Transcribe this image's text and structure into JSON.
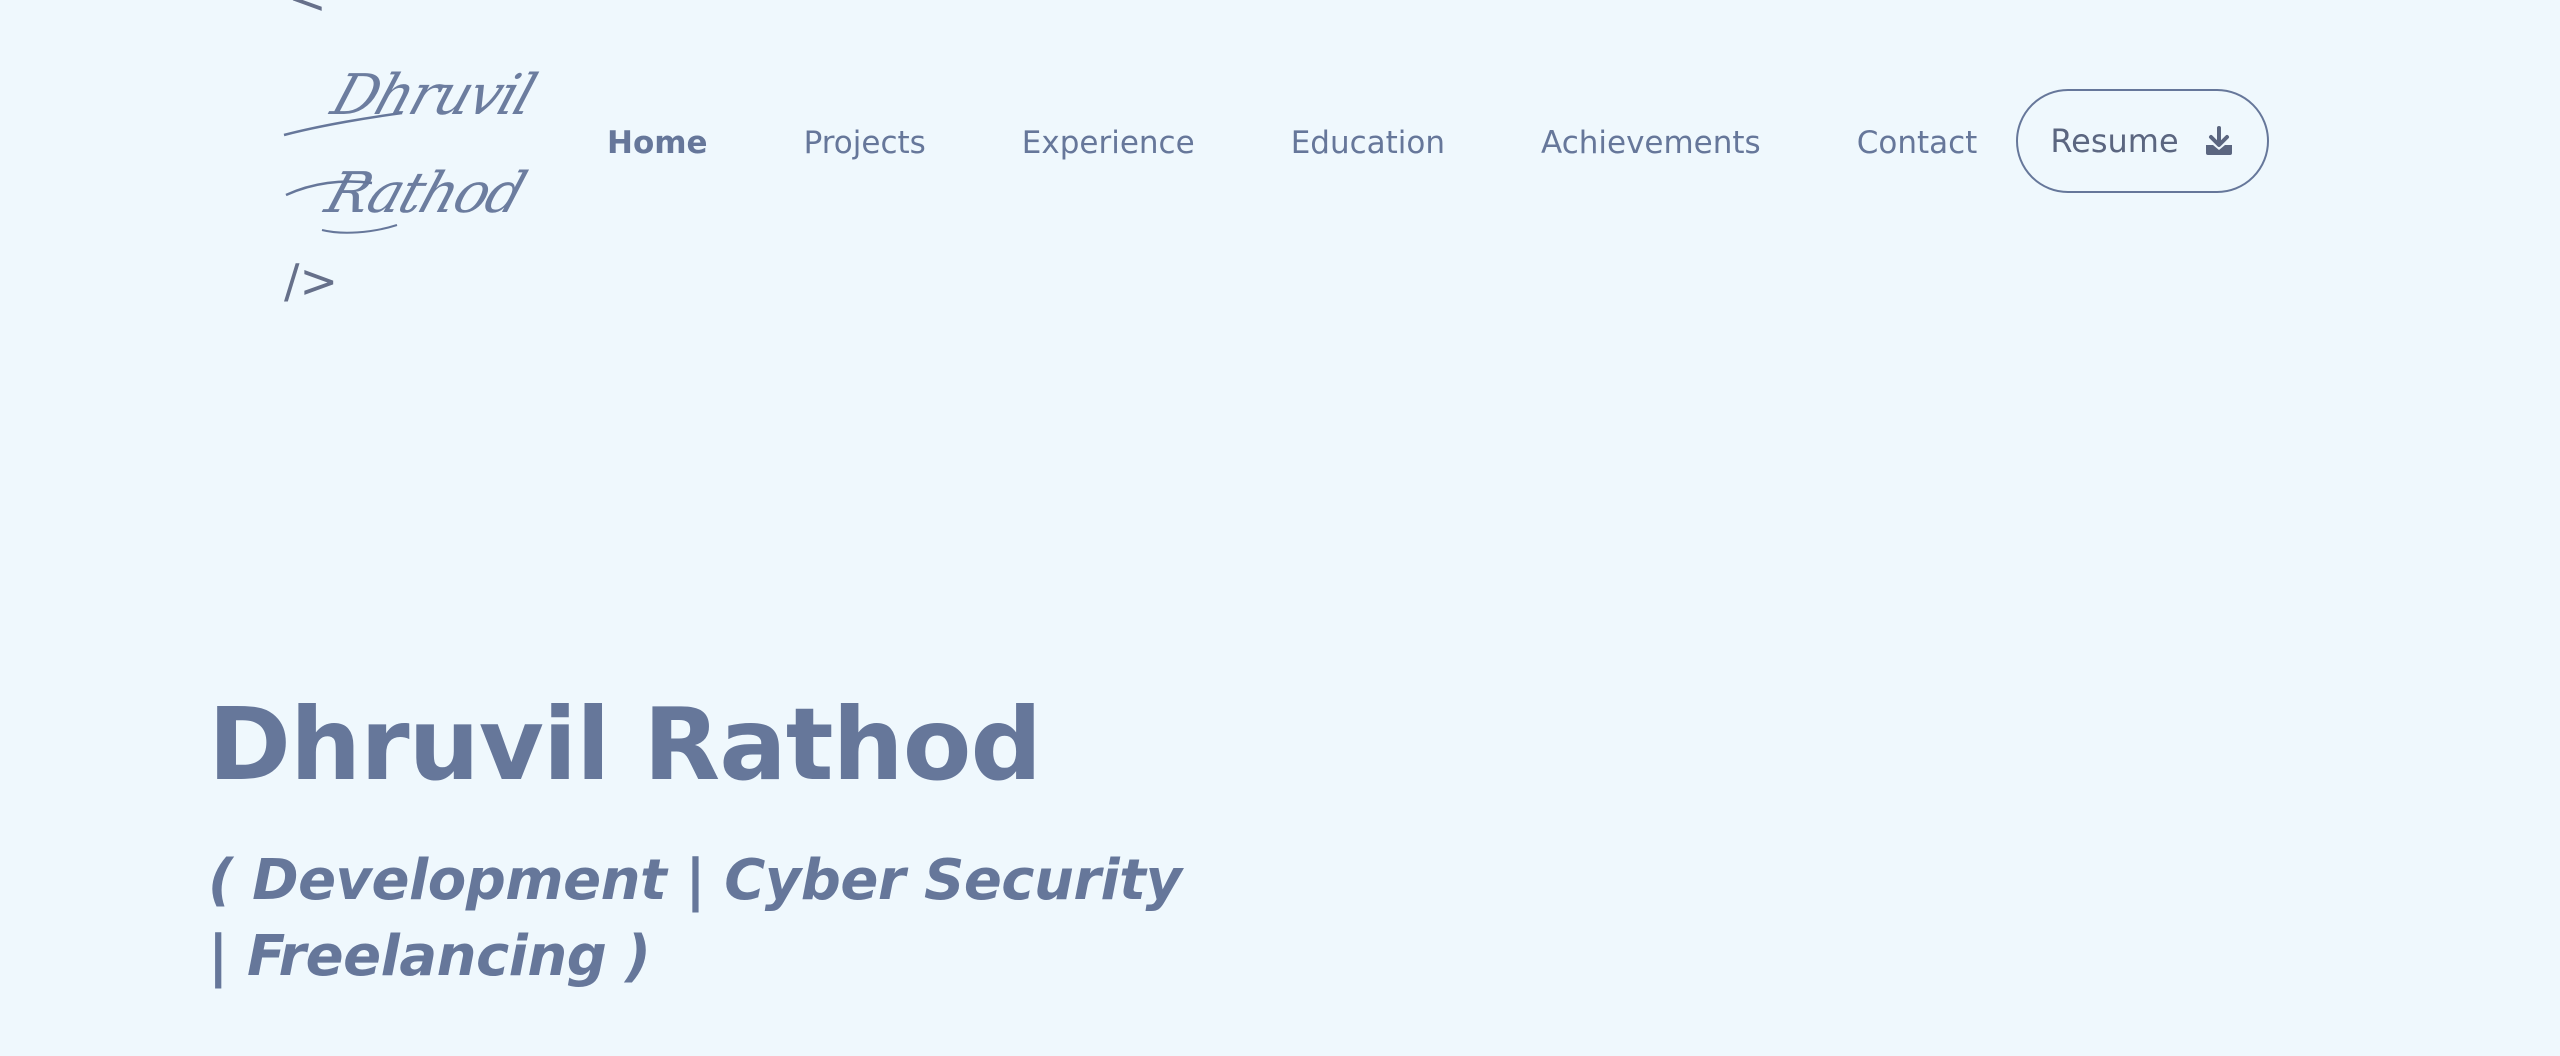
{
  "logo": {
    "bracket_open": "<",
    "signature_line1": "Dhruvil",
    "signature_line2": "Rathod",
    "bracket_close": "/>"
  },
  "nav": {
    "items": [
      {
        "label": "Home",
        "active": true
      },
      {
        "label": "Projects",
        "active": false
      },
      {
        "label": "Experience",
        "active": false
      },
      {
        "label": "Education",
        "active": false
      },
      {
        "label": "Achievements",
        "active": false
      },
      {
        "label": "Contact",
        "active": false
      }
    ],
    "resume": {
      "label": "Resume",
      "icon": "download-icon"
    }
  },
  "hero": {
    "name": "Dhruvil Rathod",
    "tagline": "( Development | Cyber Security | Freelancing )"
  },
  "colors": {
    "background": "#eff8fd",
    "text": "#66779a",
    "button_border": "#66779a"
  }
}
